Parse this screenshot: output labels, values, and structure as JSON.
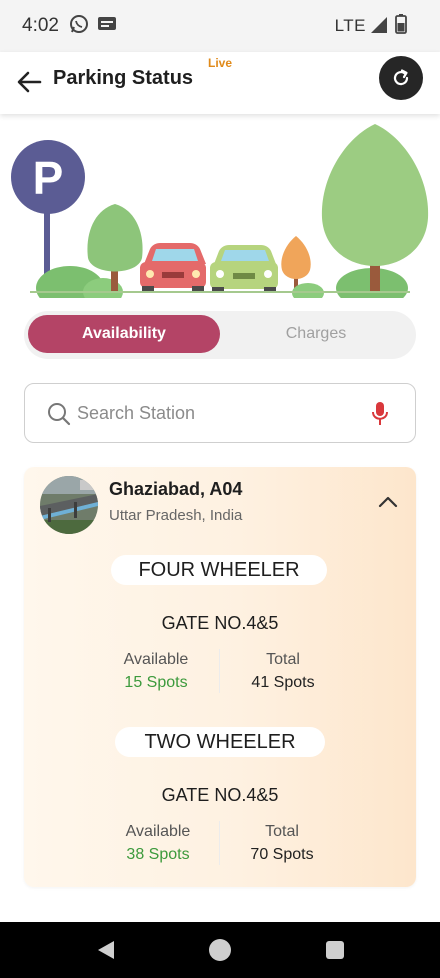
{
  "status_bar": {
    "time": "4:02",
    "network": "LTE",
    "icons": [
      "whatsapp-icon",
      "message-icon",
      "signal-icon",
      "battery-icon"
    ]
  },
  "app_bar": {
    "title": "Parking Status",
    "live_badge": "Live",
    "back_icon": "arrow-left-icon",
    "refresh_icon": "refresh-icon"
  },
  "illustration": {
    "sign_letter": "P"
  },
  "tabs": [
    {
      "label": "Availability",
      "active": true
    },
    {
      "label": "Charges",
      "active": false
    }
  ],
  "search": {
    "placeholder": "Search Station",
    "search_icon": "search-icon",
    "mic_icon": "mic-icon"
  },
  "station": {
    "name": "Ghaziabad, A04",
    "location": "Uttar Pradesh, India",
    "sections": [
      {
        "vehicle": "FOUR WHEELER",
        "gate": "GATE NO.4&5",
        "available_label": "Available",
        "available": "15 Spots",
        "total_label": "Total",
        "total": "41 Spots"
      },
      {
        "vehicle": "TWO WHEELER",
        "gate": "GATE NO.4&5",
        "available_label": "Available",
        "available": "38 Spots",
        "total_label": "Total",
        "total": "70 Spots"
      }
    ]
  },
  "colors": {
    "accent": "#b44466",
    "available_green": "#3c9a3c",
    "live_orange": "#e08a1a"
  }
}
